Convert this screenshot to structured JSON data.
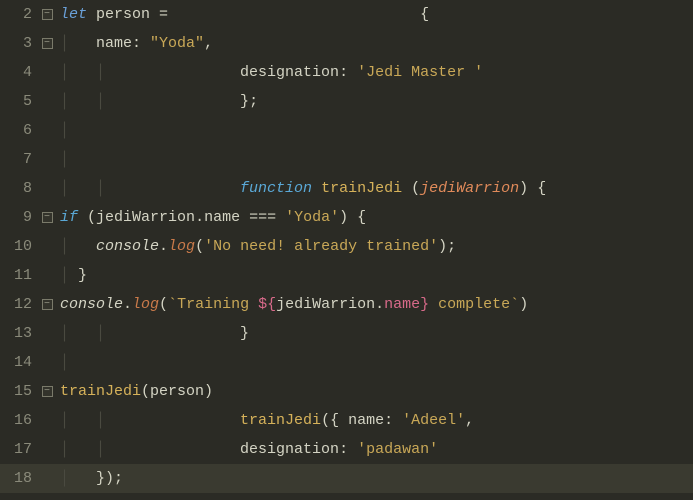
{
  "lines": [
    {
      "num": "2",
      "fold": true
    },
    {
      "num": "3",
      "fold": true
    },
    {
      "num": "4",
      "fold": false
    },
    {
      "num": "5",
      "fold": false
    },
    {
      "num": "6",
      "fold": false
    },
    {
      "num": "7",
      "fold": false
    },
    {
      "num": "8",
      "fold": false
    },
    {
      "num": "9",
      "fold": true
    },
    {
      "num": "10",
      "fold": false
    },
    {
      "num": "11",
      "fold": false
    },
    {
      "num": "12",
      "fold": true
    },
    {
      "num": "13",
      "fold": false
    },
    {
      "num": "14",
      "fold": false
    },
    {
      "num": "15",
      "fold": true
    },
    {
      "num": "16",
      "fold": false
    },
    {
      "num": "17",
      "fold": false
    },
    {
      "num": "18",
      "fold": false
    }
  ],
  "tok": {
    "let": "let",
    "person": "person",
    "eq": " = ",
    "lbrace": "{",
    "rbrace": "}",
    "name": "name",
    "colon": ": ",
    "yoda": "\"Yoda\"",
    "comma": ",",
    "designation": "designation",
    "jediMaster": "'Jedi Master '",
    "semi": ";",
    "function": "function",
    "trainJedi": "trainJedi",
    "sp": " ",
    "lparen": "(",
    "rparen": ")",
    "jediWarrion": "jediWarrion",
    "if": "if",
    "dot": ".",
    "eqeq": " === ",
    "yodaSingle": "'Yoda'",
    "console": "console",
    "log": "log",
    "noNeed": "'No need! already trained'",
    "bt1": "`Training ",
    "dollar": "${",
    "rcb": "}",
    "bt2": " complete`",
    "adeelLine": "{ name: ",
    "adeel": "'Adeel'",
    "padawan": "'padawan'",
    "closeObj": "});",
    "foldMinus": "−"
  },
  "indent": {
    "g1": "│   ",
    "g2": "│   │   "
  }
}
